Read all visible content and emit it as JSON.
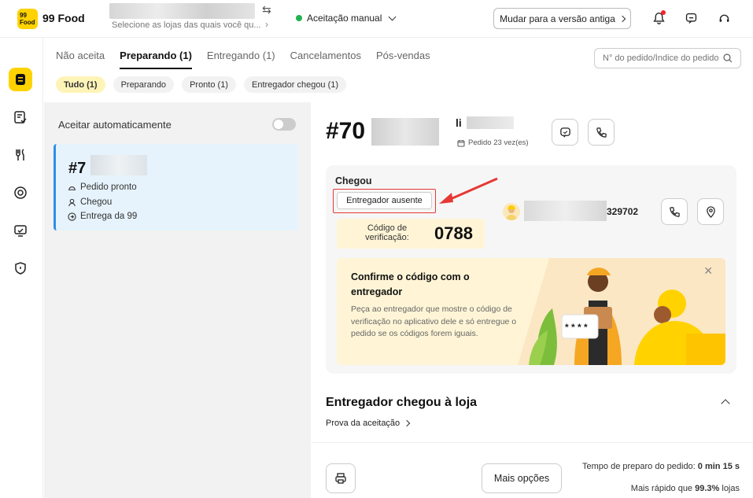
{
  "header": {
    "logo_text": "99 Food",
    "logo_badge": "99\nFood",
    "store_hint": "Selecione as lojas das quais você qu...",
    "accept_mode": "Aceitação manual",
    "old_version_label": "Mudar para a versão antiga",
    "icons": [
      "bell-icon",
      "chat-icon",
      "support-icon"
    ]
  },
  "tabs": [
    {
      "label": "Não aceita",
      "active": false
    },
    {
      "label": "Preparando (1)",
      "active": true
    },
    {
      "label": "Entregando (1)",
      "active": false
    },
    {
      "label": "Cancelamentos",
      "active": false
    },
    {
      "label": "Pós-vendas",
      "active": false
    }
  ],
  "search": {
    "placeholder": "N° do pedido/Índice do pedido"
  },
  "filters": [
    {
      "label": "Tudo (1)",
      "active": true
    },
    {
      "label": "Preparando",
      "active": false
    },
    {
      "label": "Pronto (1)",
      "active": false
    },
    {
      "label": "Entregador chegou (1)",
      "active": false
    }
  ],
  "list": {
    "auto_accept_label": "Aceitar automaticamente",
    "auto_accept_on": false,
    "order_card": {
      "number_prefix": "#7",
      "status_ready": "Pedido pronto",
      "status_arrived": "Chegou",
      "delivery_by": "Entrega da 99"
    }
  },
  "detail": {
    "order_prefix": "#70",
    "customer_initial": "li",
    "order_count": "Pedido 23 vez(es)",
    "arrived_title": "Chegou",
    "absent_button": "Entregador ausente",
    "code_label": "Código de verificação:",
    "code_value": "0788",
    "courier_phone_suffix": "329702",
    "confirm_title": "Confirme o código com o entregador",
    "confirm_body": "Peça ao entregador que mostre o código de verificação no aplicativo dele e só entregue o pedido se os códigos forem iguais.",
    "speech_text": "* * * *",
    "section_title": "Entregador chegou à loja",
    "proof_link": "Prova da aceitação",
    "more_options": "Mais opções",
    "prep_time_label": "Tempo de preparo do pedido: ",
    "prep_time_value": "0 min 15 s",
    "faster_label": "Mais rápido que ",
    "faster_value": "99.3%",
    "faster_suffix": " lojas"
  },
  "colors": {
    "brand": "#FFD200",
    "accent_blue": "#2C8EEB",
    "highlight_red": "#E53935",
    "status_green": "#21B24D"
  }
}
